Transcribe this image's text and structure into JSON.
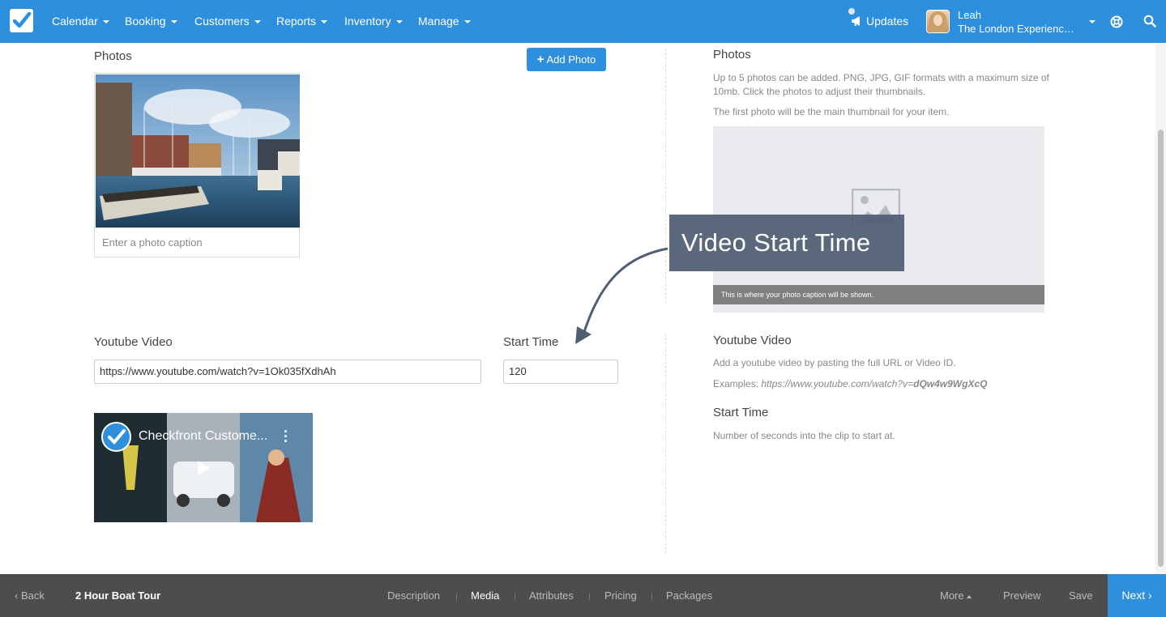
{
  "nav": {
    "items": [
      {
        "label": "Calendar"
      },
      {
        "label": "Booking"
      },
      {
        "label": "Customers"
      },
      {
        "label": "Reports"
      },
      {
        "label": "Inventory"
      },
      {
        "label": "Manage"
      }
    ],
    "updates_label": "Updates",
    "user_name": "Leah",
    "user_org": "The London Experience Co."
  },
  "photos": {
    "heading": "Photos",
    "add_button": "Add Photo",
    "caption_placeholder": "Enter a photo caption"
  },
  "video": {
    "heading": "Youtube Video",
    "url_value": "https://www.youtube.com/watch?v=1Ok035fXdhAh",
    "start_heading": "Start Time",
    "start_value": "120",
    "thumb_title": "Checkfront Custome..."
  },
  "help": {
    "photos_title": "Photos",
    "photos_text1": "Up to 5 photos can be added. PNG, JPG, GIF formats with a maximum size of 10mb. Click the photos to adjust their thumbnails.",
    "photos_text2": "The first photo will be the main thumbnail for your item.",
    "preview_caption": "This is where your photo caption will be shown.",
    "video_title": "Youtube Video",
    "video_text": "Add a youtube video by pasting the full URL or Video ID.",
    "examples_label": "Examples: ",
    "examples_url": "https://www.youtube.com/watch?v=",
    "examples_id": "dQw4w9WgXcQ",
    "start_title": "Start Time",
    "start_text": "Number of seconds into the clip to start at."
  },
  "callout": {
    "text": "Video Start Time"
  },
  "bottom": {
    "back": "Back",
    "item_title": "2 Hour Boat Tour",
    "tabs": [
      {
        "label": "Description"
      },
      {
        "label": "Media"
      },
      {
        "label": "Attributes"
      },
      {
        "label": "Pricing"
      },
      {
        "label": "Packages"
      }
    ],
    "more": "More",
    "preview": "Preview",
    "save": "Save",
    "next": "Next"
  }
}
